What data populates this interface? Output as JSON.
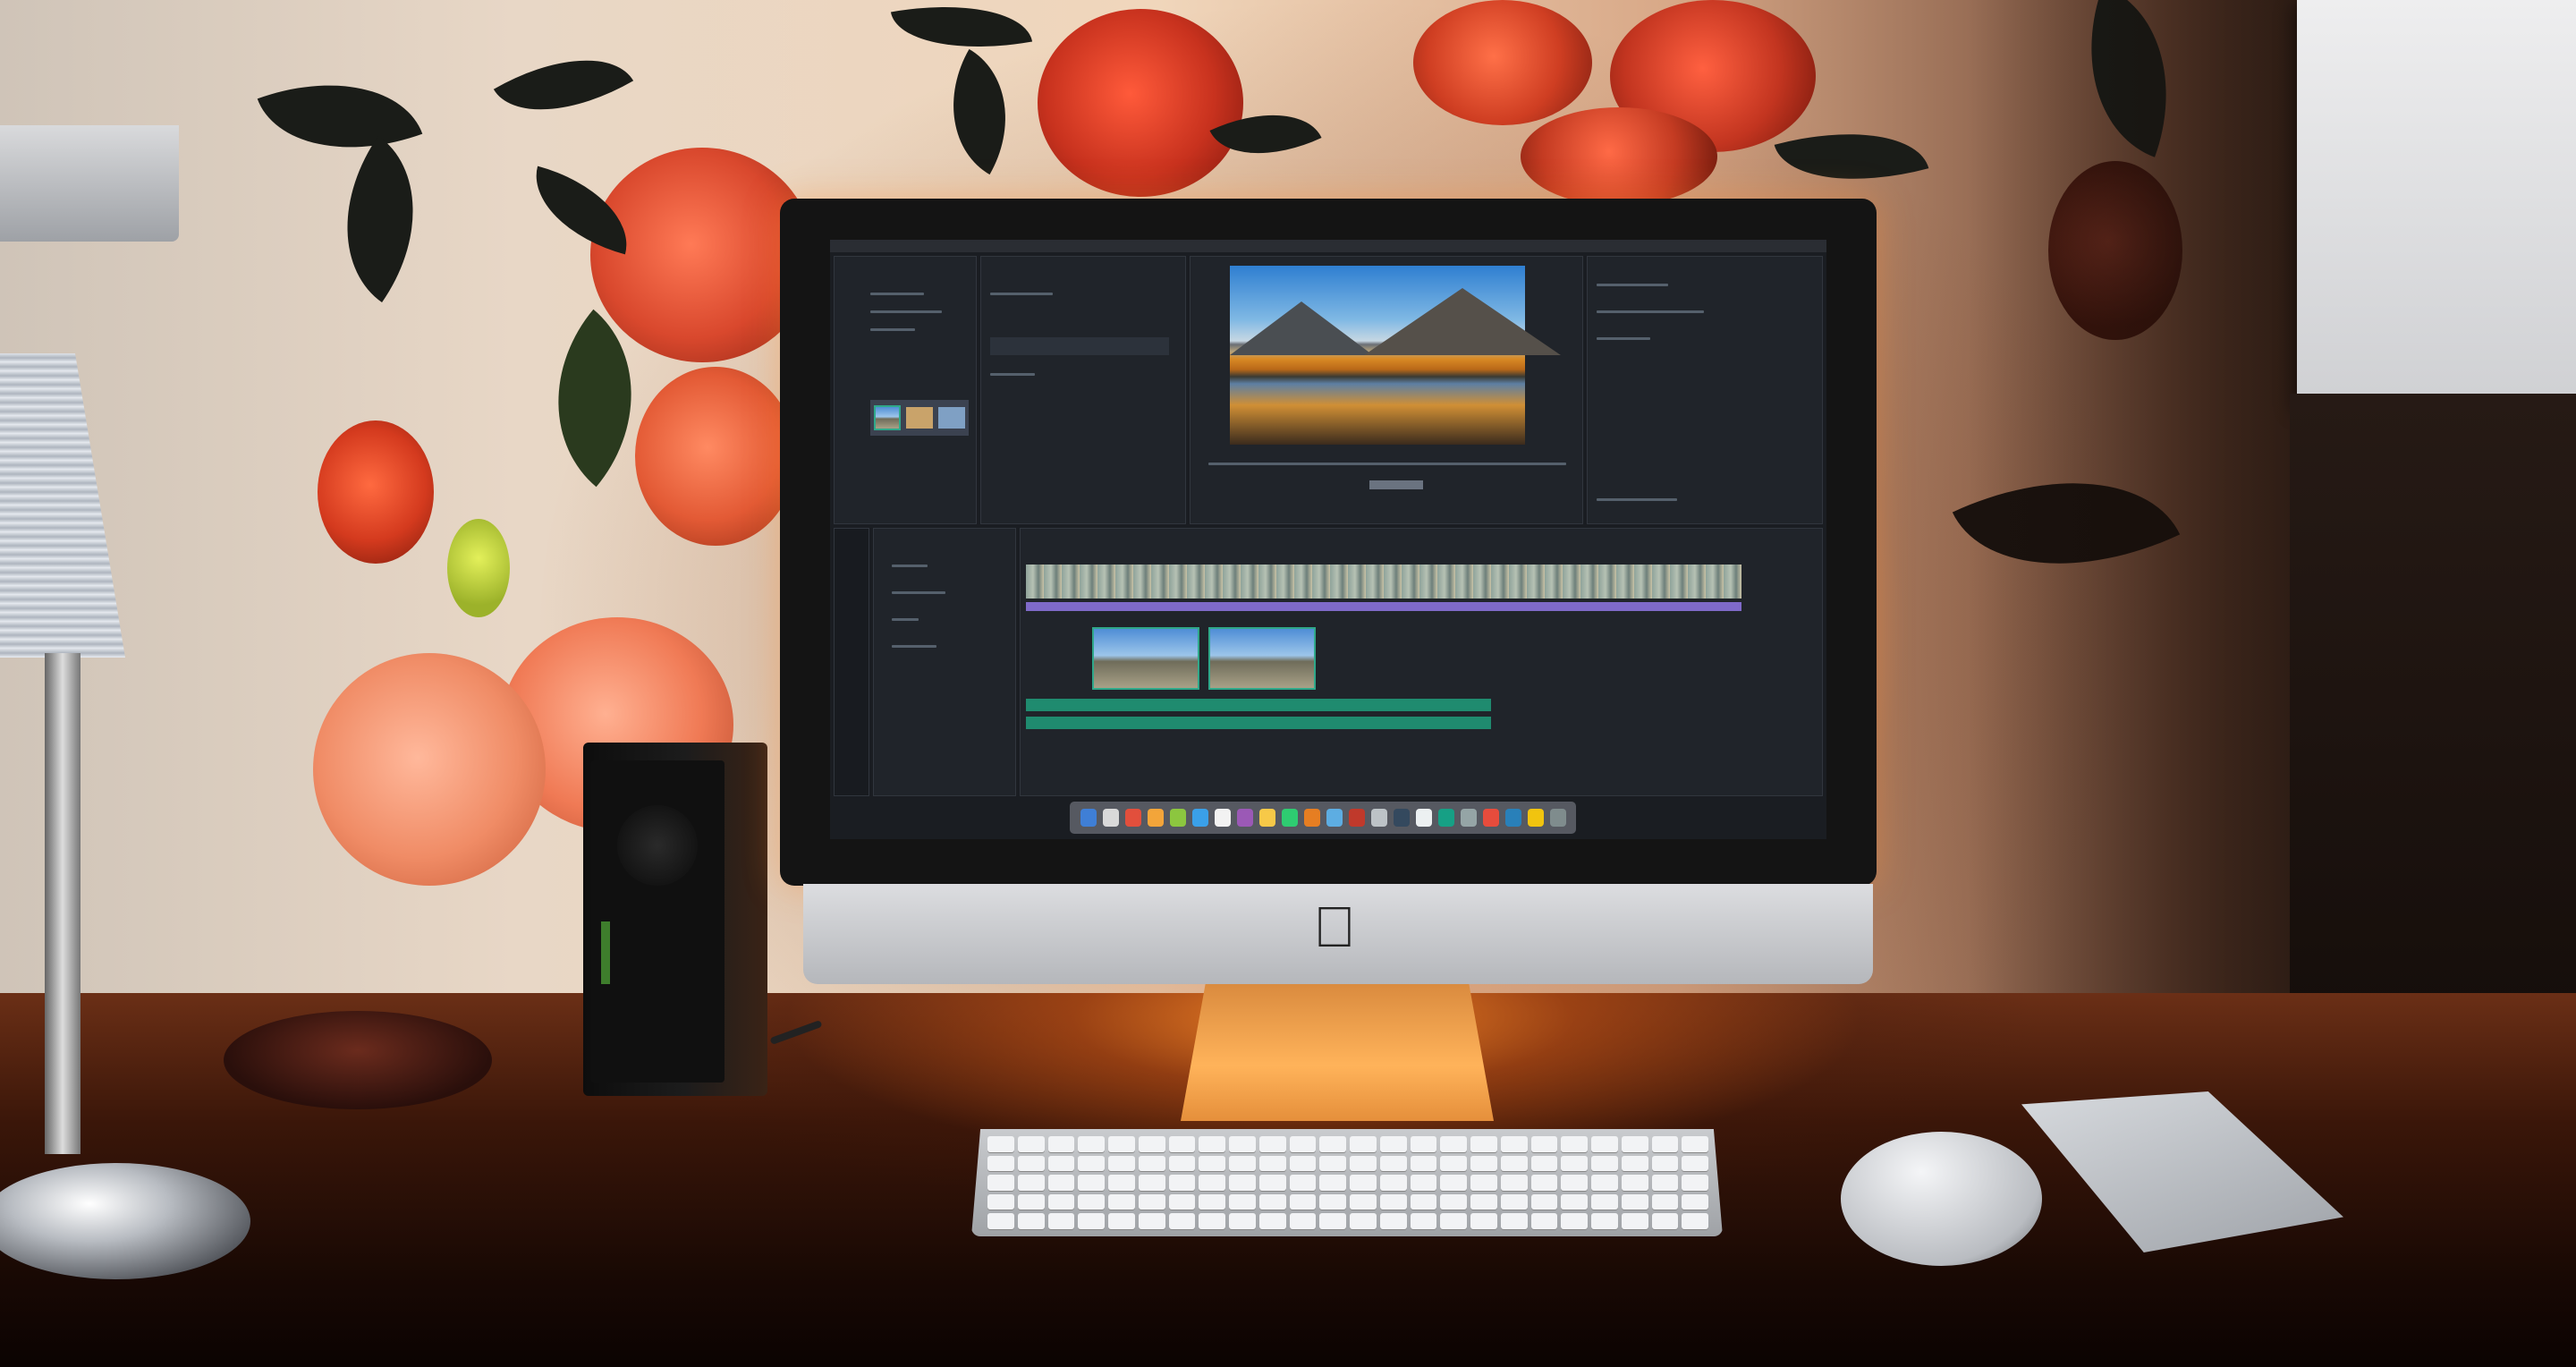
{
  "scene": {
    "description_free": true,
    "screen_app": {
      "menu_items": [],
      "dock_icon_colors": [
        "#3f7fd6",
        "#d9d9d9",
        "#e24f3c",
        "#f3a53a",
        "#8cc63f",
        "#3aa0e8",
        "#f2f2f2",
        "#9b59b6",
        "#f7c948",
        "#2ecc71",
        "#e67e22",
        "#5dade2",
        "#c0392b",
        "#bdc3c7",
        "#34495e",
        "#ecf0f1",
        "#16a085",
        "#95a5a6",
        "#e74c3c",
        "#2980b9",
        "#f1c40f",
        "#7f8c8d"
      ]
    },
    "logo": ""
  }
}
